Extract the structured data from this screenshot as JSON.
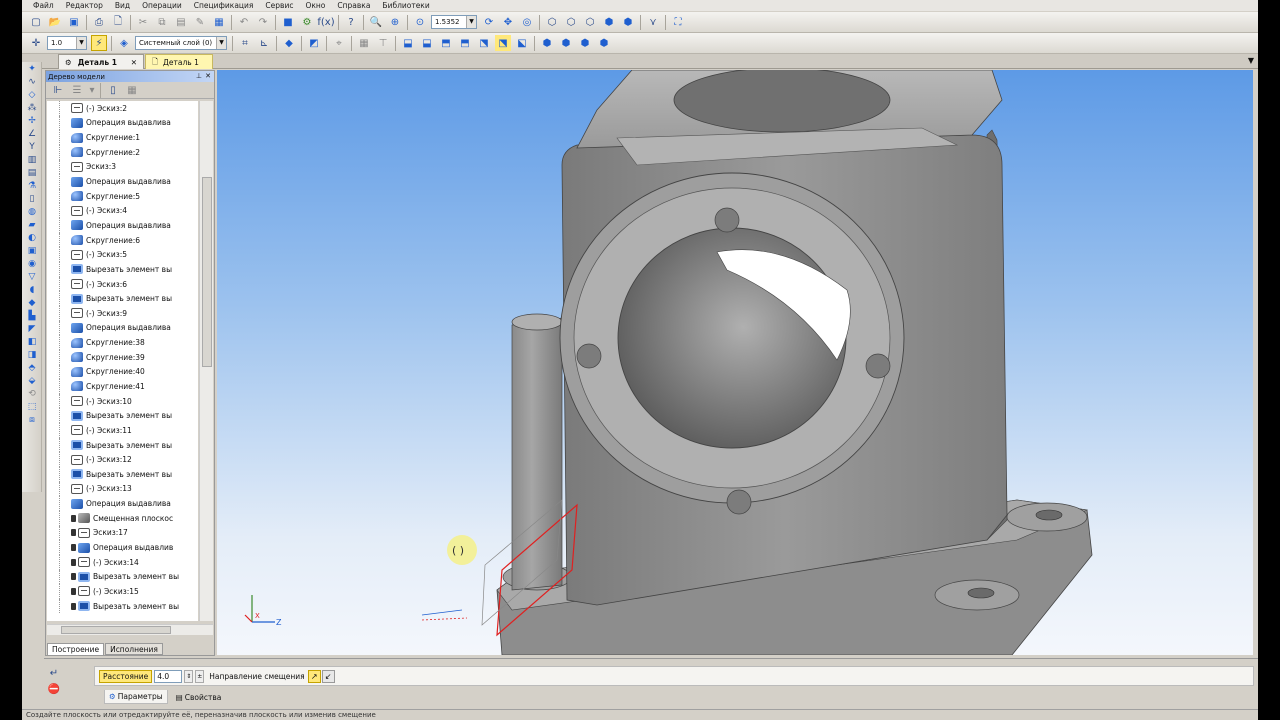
{
  "menu": [
    "Файл",
    "Редактор",
    "Вид",
    "Операции",
    "Спецификация",
    "Сервис",
    "Окно",
    "Справка",
    "Библиотеки"
  ],
  "toolbar1": {
    "zoom_value": "1.5352"
  },
  "toolbar2": {
    "step_value": "1.0",
    "layer_value": "Системный слой (0)"
  },
  "doc_tabs": {
    "active": "Деталь 1",
    "second": "Деталь 1"
  },
  "tree": {
    "title": "Дерево модели",
    "items": [
      {
        "icon": "sketch",
        "label": "(-) Эскиз:2"
      },
      {
        "icon": "extrude",
        "label": "Операция выдавлива"
      },
      {
        "icon": "fillet",
        "label": "Скругление:1"
      },
      {
        "icon": "fillet",
        "label": "Скругление:2"
      },
      {
        "icon": "sketch",
        "label": "Эскиз:3"
      },
      {
        "icon": "extrude",
        "label": "Операция выдавлива"
      },
      {
        "icon": "fillet",
        "label": "Скругление:5"
      },
      {
        "icon": "sketch",
        "label": "(-) Эскиз:4"
      },
      {
        "icon": "extrude",
        "label": "Операция выдавлива"
      },
      {
        "icon": "fillet",
        "label": "Скругление:6"
      },
      {
        "icon": "sketch",
        "label": "(-) Эскиз:5"
      },
      {
        "icon": "cut",
        "label": "Вырезать элемент вы"
      },
      {
        "icon": "sketch",
        "label": "(-) Эскиз:6"
      },
      {
        "icon": "cut",
        "label": "Вырезать элемент вы"
      },
      {
        "icon": "sketch",
        "label": "(-) Эскиз:9"
      },
      {
        "icon": "extrude",
        "label": "Операция выдавлива"
      },
      {
        "icon": "fillet",
        "label": "Скругление:38"
      },
      {
        "icon": "fillet",
        "label": "Скругление:39"
      },
      {
        "icon": "fillet",
        "label": "Скругление:40"
      },
      {
        "icon": "fillet",
        "label": "Скругление:41"
      },
      {
        "icon": "sketch",
        "label": "(-) Эскиз:10"
      },
      {
        "icon": "cut",
        "label": "Вырезать элемент вы"
      },
      {
        "icon": "sketch",
        "label": "(-) Эскиз:11"
      },
      {
        "icon": "cut",
        "label": "Вырезать элемент вы"
      },
      {
        "icon": "sketch",
        "label": "(-) Эскиз:12"
      },
      {
        "icon": "cut",
        "label": "Вырезать элемент вы"
      },
      {
        "icon": "sketch",
        "label": "(-) Эскиз:13"
      },
      {
        "icon": "extrude",
        "label": "Операция выдавлива"
      },
      {
        "icon": "plane",
        "label": "Смещенная плоскос",
        "locked": true
      },
      {
        "icon": "sketch",
        "label": "Эскиз:17",
        "locked": true
      },
      {
        "icon": "extrude",
        "label": "Операция выдавлив",
        "locked": true
      },
      {
        "icon": "sketch",
        "label": "(-) Эскиз:14",
        "locked": true
      },
      {
        "icon": "cut",
        "label": "Вырезать элемент вы",
        "locked": true
      },
      {
        "icon": "sketch",
        "label": "(-) Эскиз:15",
        "locked": true
      },
      {
        "icon": "cut",
        "label": "Вырезать элемент вы",
        "locked": true
      }
    ],
    "tabs": [
      "Построение",
      "Исполнения"
    ]
  },
  "props": {
    "distance_label": "Расстояние",
    "distance_value": "4.0",
    "direction_label": "Направление смещения",
    "tabs": [
      "Параметры",
      "Свойства"
    ]
  },
  "status": "Создайте плоскость или отредактируйте её, переназначив плоскость или изменив смещение",
  "colors": {
    "viewport_top": "#5d9ae6",
    "viewport_bottom": "#f4f7fc",
    "part_gray": "#8a8a8a",
    "plane_red": "#e02020",
    "tab_highlight": "#fff6b0"
  }
}
